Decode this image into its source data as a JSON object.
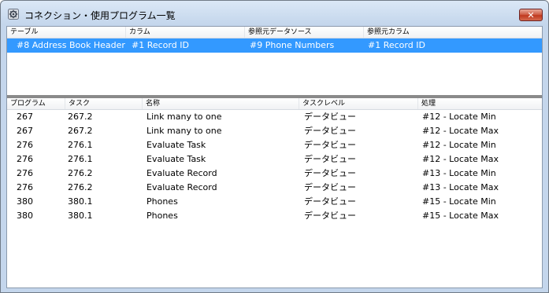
{
  "window": {
    "title": "コネクション・使用プログラム一覧",
    "close_label": "✕"
  },
  "top_table": {
    "headers": [
      "テーブル",
      "カラム",
      "参照元データソース",
      "参照元カラム"
    ],
    "rows": [
      [
        "#8 Address Book Header",
        "#1 Record ID",
        "#9 Phone Numbers",
        "#1 Record ID"
      ]
    ]
  },
  "bottom_table": {
    "headers": [
      "プログラム",
      "タスク",
      "名称",
      "タスクレベル",
      "処理"
    ],
    "rows": [
      [
        "267",
        "267.2",
        "Link many to one",
        "データビュー",
        "#12 - Locate Min"
      ],
      [
        "267",
        "267.2",
        "Link many to one",
        "データビュー",
        "#12 - Locate Max"
      ],
      [
        "276",
        "276.1",
        "Evaluate Task",
        "データビュー",
        "#12 - Locate Min"
      ],
      [
        "276",
        "276.1",
        "Evaluate Task",
        "データビュー",
        "#12 - Locate Max"
      ],
      [
        "276",
        "276.2",
        "Evaluate Record",
        "データビュー",
        "#13 - Locate Min"
      ],
      [
        "276",
        "276.2",
        "Evaluate Record",
        "データビュー",
        "#13 - Locate Max"
      ],
      [
        "380",
        "380.1",
        "Phones",
        "データビュー",
        "#15 - Locate Min"
      ],
      [
        "380",
        "380.1",
        "Phones",
        "データビュー",
        "#15 - Locate Max"
      ]
    ]
  },
  "colors": {
    "selection": "#3399ff",
    "close_button": "#c0391f"
  }
}
